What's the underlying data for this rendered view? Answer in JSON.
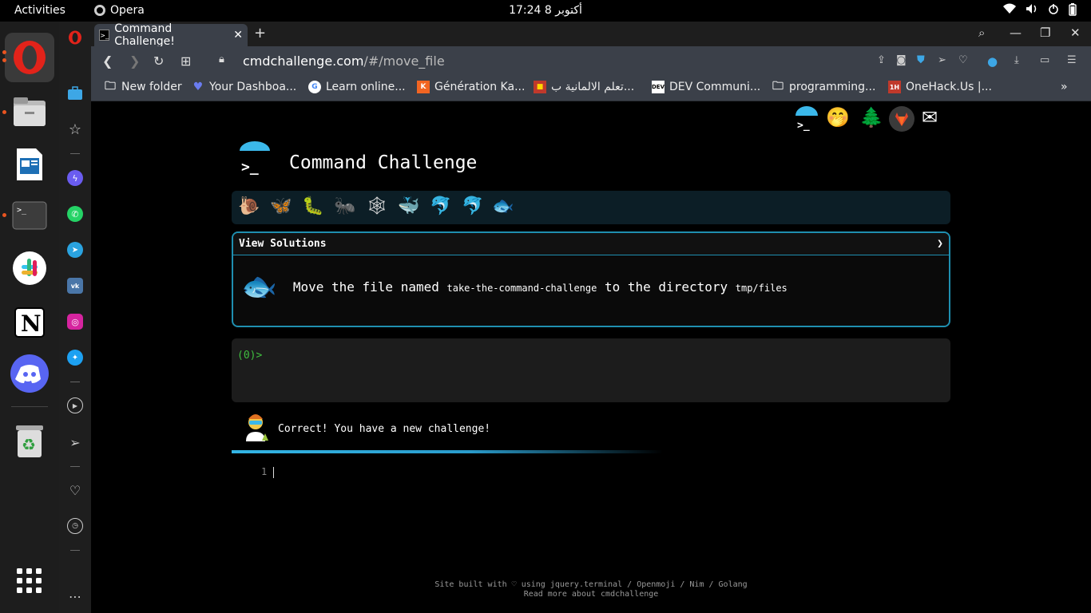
{
  "topbar": {
    "activities": "Activities",
    "app_name": "Opera",
    "clock": "أكتوبر 8  17:24",
    "tray_icons": [
      "wifi-icon",
      "volume-icon",
      "power-icon",
      "battery-icon"
    ]
  },
  "dock": {
    "items": [
      "opera-browser",
      "files",
      "libreoffice-writer",
      "terminal",
      "slack",
      "notion",
      "discord",
      "trash"
    ],
    "show_apps_icon": "grid-icon"
  },
  "sidebar": {
    "icons": [
      "opera-logo",
      "workspaces",
      "favorites-star",
      "messenger",
      "whatsapp",
      "telegram",
      "vk",
      "instagram",
      "twitter",
      "player",
      "flow",
      "my-heart",
      "history",
      "more"
    ]
  },
  "browser": {
    "tab_title": "Command Challenge!",
    "tab_favicon": ">_",
    "url_domain": "cmdchallenge.com",
    "url_path": "/#/move_file",
    "bookmarks": [
      {
        "label": "New folder",
        "icon": "folder-icon"
      },
      {
        "label": "Your Dashboa...",
        "icon": "heart-gem-icon"
      },
      {
        "label": "Learn online...",
        "icon": "google-icon"
      },
      {
        "label": "Génération Ka...",
        "icon": "kadi-icon"
      },
      {
        "label": "تعلم الالمانية ب...",
        "icon": "flag-icon"
      },
      {
        "label": "DEV Communi...",
        "icon": "dev-icon"
      },
      {
        "label": "programming...",
        "icon": "folder-icon"
      },
      {
        "label": "OneHack.Us |...",
        "icon": "onehack-icon"
      }
    ]
  },
  "page": {
    "title": "Command Challenge",
    "level_icons": [
      "🐌",
      "🦋",
      "🐛",
      "🐜",
      "🕸",
      "🐳",
      "🐬",
      "🐬",
      "🐟"
    ],
    "top_icons": [
      "terminal-umbrella",
      "🤭",
      "🌲",
      "gitlab",
      "✉"
    ],
    "solutions_label": "View Solutions",
    "chevron": "❯",
    "task_prefix": "Move the file named",
    "task_file": "take-the-command-challenge",
    "task_mid": "to the directory",
    "task_dir": "tmp/files",
    "prompt": "(0)>",
    "result_message": "Correct! You have a new challenge!",
    "editor_line": "1",
    "footer_line1": "Site built with ♡ using jquery.terminal / Openmoji / Nim / Golang",
    "footer_line2": "Read more about cmdchallenge"
  },
  "colors": {
    "accent": "#33b5e5",
    "prompt_green": "#3fbf3f",
    "opera_red": "#e2231a"
  }
}
